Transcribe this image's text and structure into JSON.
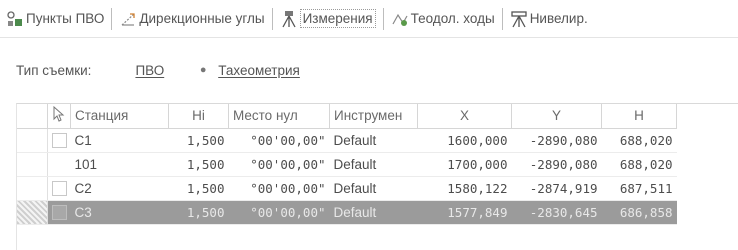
{
  "tabs": [
    {
      "label": "Пункты ПВО",
      "icon": "points-icon",
      "active": false
    },
    {
      "label": "Дирекционные углы",
      "icon": "angle-icon",
      "active": false
    },
    {
      "label": "Измерения",
      "icon": "tripod-icon",
      "active": true
    },
    {
      "label": "Теодол. ходы",
      "icon": "traverse-icon",
      "active": false
    },
    {
      "label": "Нивелир.",
      "icon": "level-icon",
      "active": false
    }
  ],
  "survey": {
    "label": "Тип съемки:",
    "options": [
      {
        "label": "ПВО",
        "selected": false
      },
      {
        "label": "Тахеометрия",
        "selected": true
      }
    ]
  },
  "table": {
    "columns": [
      "Станция",
      "Hi",
      "Место нул",
      "Инструмен",
      "X",
      "Y",
      "H"
    ],
    "rows": [
      {
        "station": "C1",
        "hi": "1,500",
        "zero": "°00'00,00\"",
        "instrument": "Default",
        "x": "1600,000",
        "y": "-2890,080",
        "h": "688,020"
      },
      {
        "station": "101",
        "hi": "1,500",
        "zero": "°00'00,00\"",
        "instrument": "Default",
        "x": "1700,000",
        "y": "-2890,080",
        "h": "688,020"
      },
      {
        "station": "C2",
        "hi": "1,500",
        "zero": "°00'00,00\"",
        "instrument": "Default",
        "x": "1580,122",
        "y": "-2874,919",
        "h": "687,511"
      },
      {
        "station": "C3",
        "hi": "1,500",
        "zero": "°00'00,00\"",
        "instrument": "Default",
        "x": "1577,849",
        "y": "-2830,645",
        "h": "686,858",
        "selected": true
      }
    ]
  }
}
